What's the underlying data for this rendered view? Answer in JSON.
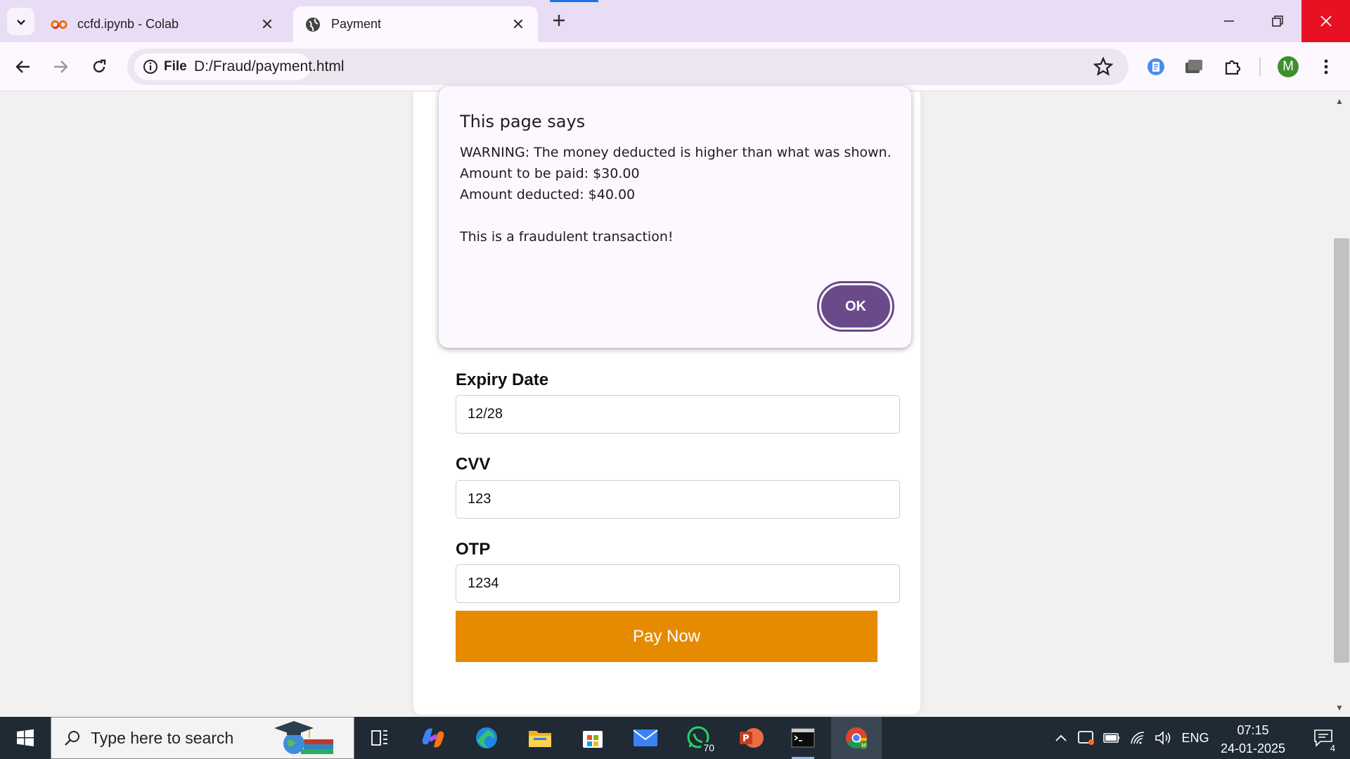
{
  "browser": {
    "tabs": [
      {
        "title": "ccfd.ipynb - Colab",
        "icon": "colab-icon",
        "active": false
      },
      {
        "title": "Payment",
        "icon": "globe-icon",
        "active": true
      }
    ],
    "address_chip": "File",
    "url": "D:/Fraud/payment.html",
    "profile_initial": "M"
  },
  "page": {
    "fields": [
      {
        "label": "Expiry Date",
        "value": "12/28"
      },
      {
        "label": "CVV",
        "value": "123"
      },
      {
        "label": "OTP",
        "value": "1234"
      }
    ],
    "pay_button": "Pay Now"
  },
  "dialog": {
    "title": "This page says",
    "lines": [
      "WARNING: The money deducted is higher than what was shown.",
      "Amount to be paid: $30.00",
      "Amount deducted: $40.00",
      "This is a fraudulent transaction!"
    ],
    "ok_label": "OK"
  },
  "taskbar": {
    "search_placeholder": "Type here to search",
    "whatsapp_badge": "70",
    "language": "ENG",
    "time": "07:15",
    "date": "24-01-2025",
    "notification_count": "4"
  },
  "colors": {
    "accent": "#6b4a8a",
    "pay_button": "#e68a00",
    "tabstrip": "#e9ddf6",
    "close_red": "#e81123"
  }
}
